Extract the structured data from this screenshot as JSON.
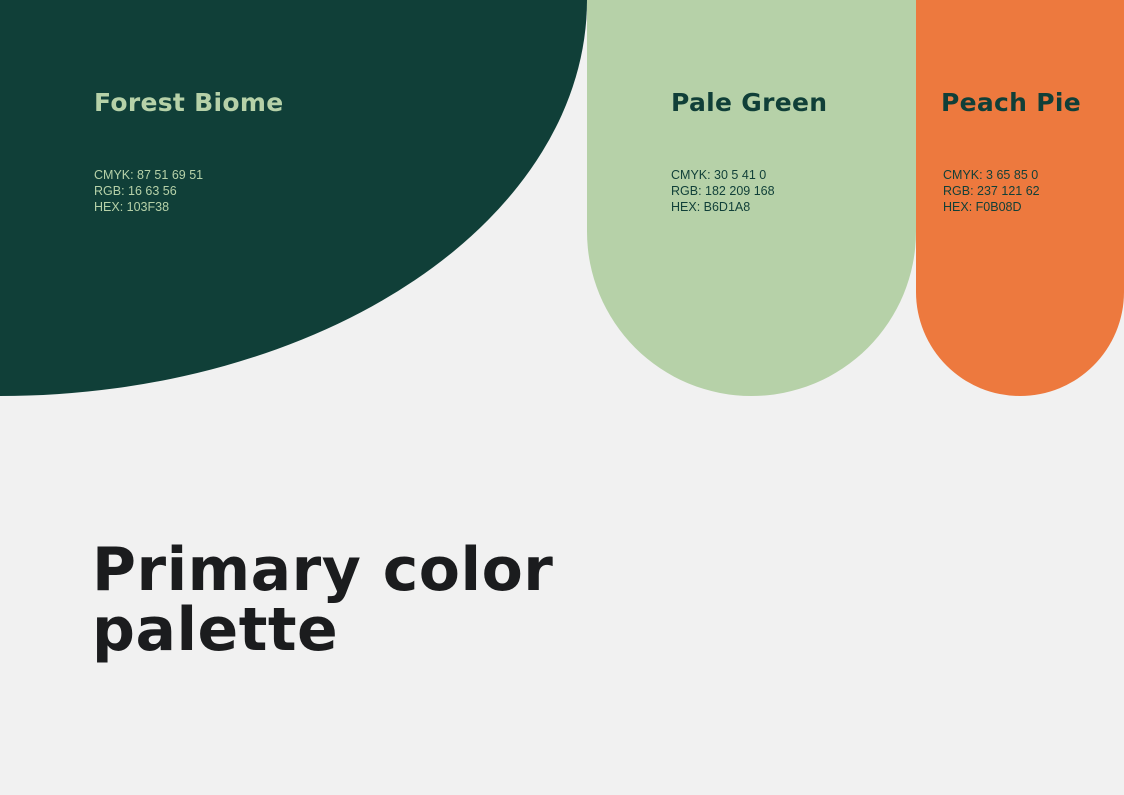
{
  "title": "Primary color palette",
  "swatches": [
    {
      "name": "Forest Biome",
      "cmyk": "CMYK: 87 51 69 51",
      "rgb": "RGB: 16 63 56",
      "hex": "HEX: 103F38",
      "color": "#103F38",
      "text_color": "#B6D1A8"
    },
    {
      "name": "Pale Green",
      "cmyk": "CMYK: 30 5 41 0",
      "rgb": "RGB: 182 209 168",
      "hex": "HEX: B6D1A8",
      "color": "#B6D1A8",
      "text_color": "#103F38"
    },
    {
      "name": "Peach Pie",
      "cmyk": "CMYK: 3 65 85 0",
      "rgb": "RGB: 237 121 62",
      "hex": "HEX: F0B08D",
      "color": "#ED793E",
      "text_color": "#103F38"
    }
  ],
  "colors": {
    "background": "#F1F1F1",
    "title_text": "#1B1C1E"
  }
}
